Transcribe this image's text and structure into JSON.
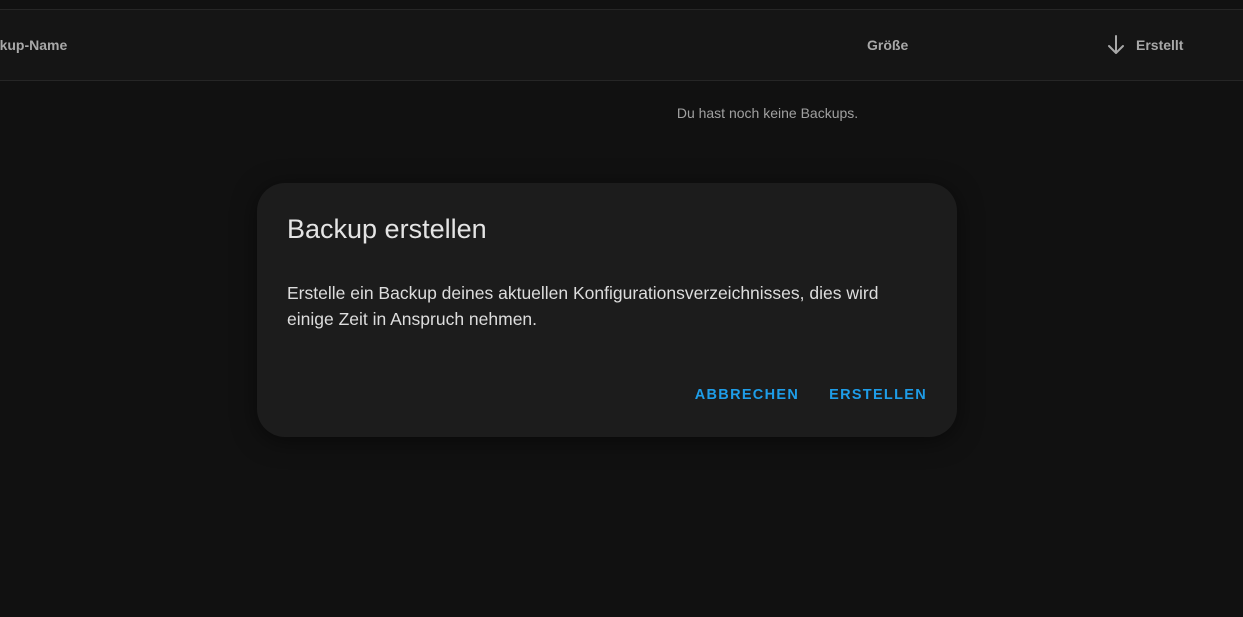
{
  "table": {
    "columns": {
      "name": "ackup-Name",
      "size": "Größe",
      "created": "Erstellt"
    },
    "sort_icon": "arrow-down-icon",
    "empty_message": "Du hast noch keine Backups."
  },
  "dialog": {
    "title": "Backup erstellen",
    "body": "Erstelle ein Backup deines aktuellen Konfigurationsverzeichnisses, dies wird einige Zeit in Anspruch nehmen.",
    "cancel_label": "ABBRECHEN",
    "confirm_label": "ERSTELLEN"
  },
  "colors": {
    "background": "#111111",
    "dialog_surface": "#1c1c1c",
    "accent": "#1e9de8",
    "header_text": "#a8a8a8"
  }
}
